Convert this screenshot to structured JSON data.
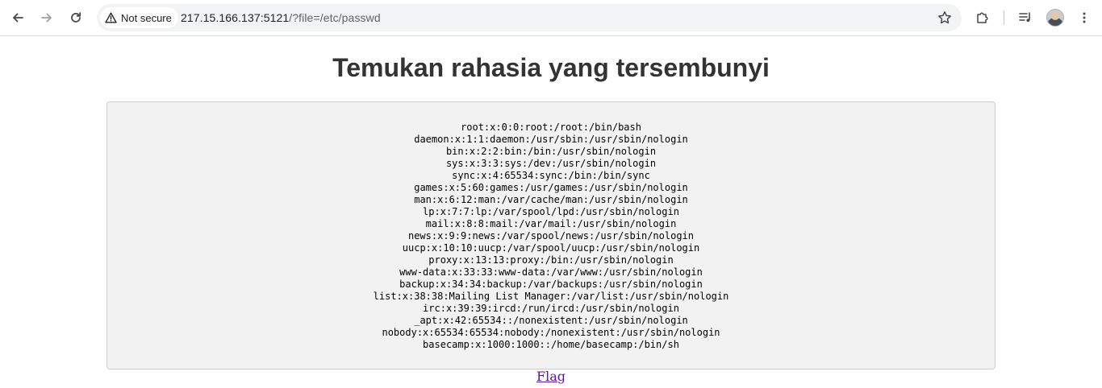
{
  "browser": {
    "security_label": "Not secure",
    "url_host": "217.15.166.137:5121",
    "url_path": "/?file=/etc/passwd"
  },
  "page": {
    "title": "Temukan rahasia yang tersembunyi",
    "file_lines": [
      "root:x:0:0:root:/root:/bin/bash",
      "daemon:x:1:1:daemon:/usr/sbin:/usr/sbin/nologin",
      "bin:x:2:2:bin:/bin:/usr/sbin/nologin",
      "sys:x:3:3:sys:/dev:/usr/sbin/nologin",
      "sync:x:4:65534:sync:/bin:/bin/sync",
      "games:x:5:60:games:/usr/games:/usr/sbin/nologin",
      "man:x:6:12:man:/var/cache/man:/usr/sbin/nologin",
      "lp:x:7:7:lp:/var/spool/lpd:/usr/sbin/nologin",
      "mail:x:8:8:mail:/var/mail:/usr/sbin/nologin",
      "news:x:9:9:news:/var/spool/news:/usr/sbin/nologin",
      "uucp:x:10:10:uucp:/var/spool/uucp:/usr/sbin/nologin",
      "proxy:x:13:13:proxy:/bin:/usr/sbin/nologin",
      "www-data:x:33:33:www-data:/var/www:/usr/sbin/nologin",
      "backup:x:34:34:backup:/var/backups:/usr/sbin/nologin",
      "list:x:38:38:Mailing List Manager:/var/list:/usr/sbin/nologin",
      "irc:x:39:39:ircd:/run/ircd:/usr/sbin/nologin",
      "_apt:x:42:65534::/nonexistent:/usr/sbin/nologin",
      "nobody:x:65534:65534:nobody:/nonexistent:/usr/sbin/nologin",
      "basecamp:x:1000:1000::/home/basecamp:/bin/sh"
    ],
    "flag_link": "Flag"
  },
  "icons": {
    "back": "back-arrow-icon",
    "forward": "forward-arrow-icon",
    "reload": "reload-icon",
    "warning": "warning-triangle-icon",
    "bookmark": "star-icon",
    "extensions": "puzzle-icon",
    "media": "media-queue-icon",
    "profile": "avatar",
    "menu": "kebab-menu-icon"
  }
}
